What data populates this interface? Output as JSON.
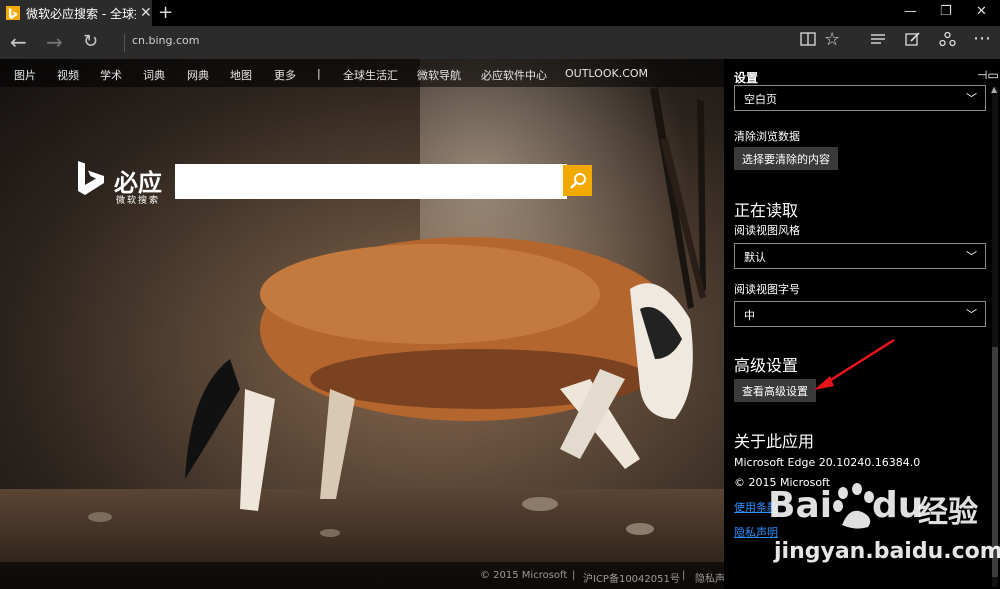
{
  "browser": {
    "tab_title": "微软必应搜索 - 全球搜索",
    "tab_close": "✕",
    "new_tab": "+",
    "url": "cn.bing.com",
    "window_controls": {
      "minimize": "—",
      "maximize": "❐",
      "close": "✕"
    }
  },
  "page": {
    "nav_links": [
      "图片",
      "视频",
      "学术",
      "词典",
      "网典",
      "地图",
      "更多",
      "|",
      "全球生活汇",
      "微软导航",
      "必应软件中心",
      "OUTLOOK.COM"
    ],
    "logo_name": "必应",
    "logo_sub": "微软搜索",
    "search_placeholder": "",
    "footer": [
      "© 2015 Microsoft",
      "|",
      "沪ICP备10042051号",
      "|",
      "隐私声"
    ]
  },
  "settings": {
    "title": "设置",
    "startup_value": "空白页",
    "clear_label": "清除浏览数据",
    "clear_button": "选择要清除的内容",
    "reading_heading": "正在读取",
    "reading_style_label": "阅读视图风格",
    "reading_style_value": "默认",
    "reading_font_label": "阅读视图字号",
    "reading_font_value": "中",
    "advanced_heading": "高级设置",
    "advanced_button": "查看高级设置",
    "about_heading": "关于此应用",
    "version": "Microsoft Edge 20.10240.16384.0",
    "copyright": "© 2015 Microsoft",
    "terms_link": "使用条款",
    "privacy_link": "隐私声明"
  },
  "watermark": {
    "brand": "Bai",
    "brand2": "du",
    "jingyan": "经验",
    "url": "jingyan.baidu.com"
  },
  "colors": {
    "accent": "#f2a900",
    "link": "#2e8fff",
    "arrow": "#e8141c"
  }
}
